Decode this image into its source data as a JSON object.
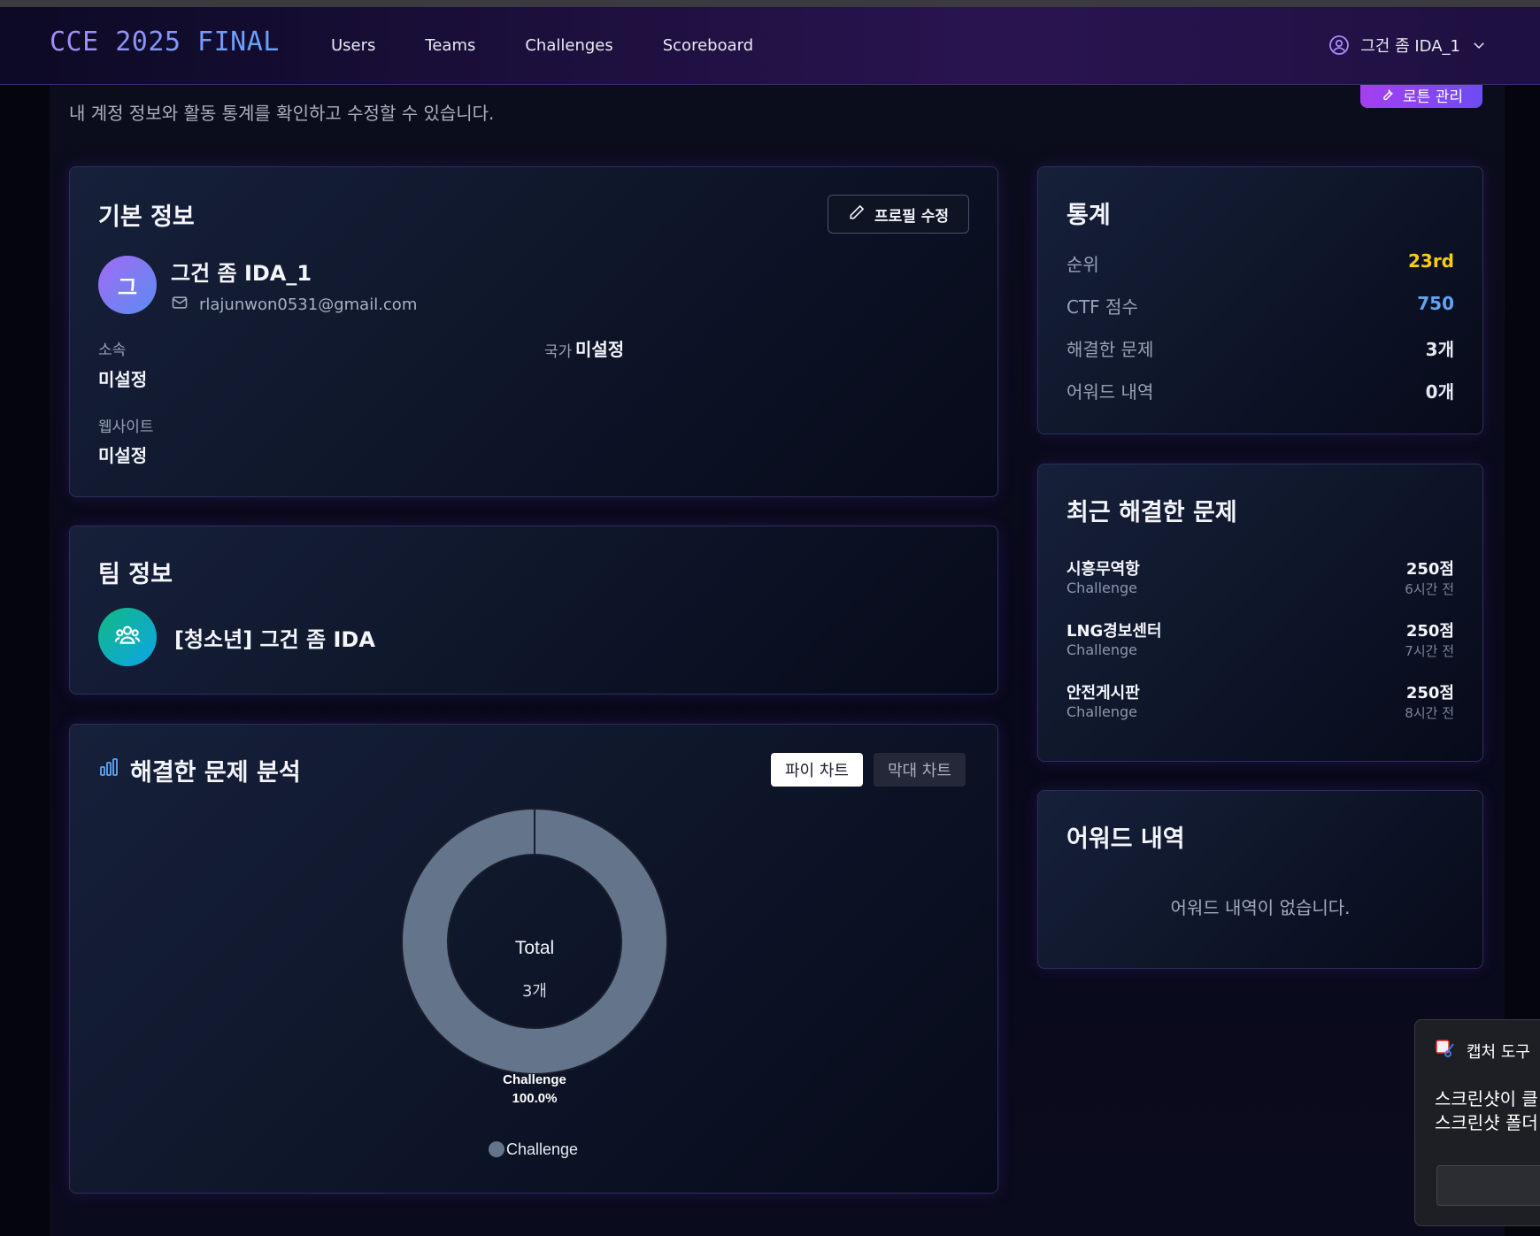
{
  "nav": {
    "brand": "CCE 2025 FINAL",
    "links": [
      "Users",
      "Teams",
      "Challenges",
      "Scoreboard"
    ],
    "user": "그건 좀 IDA_1"
  },
  "page": {
    "subtitle": "내 계정 정보와 활동 통계를 확인하고 수정할 수 있습니다.",
    "admin_button": "로튼 관리"
  },
  "basic_info": {
    "title": "기본 정보",
    "edit_button": "프로필 수정",
    "avatar_letter": "그",
    "username": "그건 좀 IDA_1",
    "email": "rlajunwon0531@gmail.com",
    "affiliation_label": "소속",
    "affiliation_value": "미설정",
    "country_label": "국가",
    "country_value": "미설정",
    "website_label": "웹사이트",
    "website_value": "미설정"
  },
  "team_info": {
    "title": "팀 정보",
    "team_name": "[청소년] 그건 좀 IDA"
  },
  "analysis": {
    "title": "해결한 문제 분석",
    "tab_pie": "파이 차트",
    "tab_bar": "막대 차트",
    "center_label": "Total",
    "center_value": "3개",
    "slice_label": "Challenge",
    "slice_percent": "100.0%",
    "legend": "Challenge",
    "colors": {
      "slice": "#64748b",
      "border": "#1a1d2b"
    }
  },
  "chart_data": {
    "type": "pie",
    "categories": [
      "Challenge"
    ],
    "values": [
      3
    ],
    "percentages": [
      100.0
    ],
    "legend": "bottom",
    "title": ""
  },
  "stats": {
    "title": "통계",
    "rows": [
      {
        "label": "순위",
        "value": "23rd",
        "color": "#facc15"
      },
      {
        "label": "CTF 점수",
        "value": "750",
        "color": "#60a5fa"
      },
      {
        "label": "해결한 문제",
        "value": "3개",
        "color": "#ffffff"
      },
      {
        "label": "어워드 내역",
        "value": "0개",
        "color": "#ffffff"
      }
    ]
  },
  "recent": {
    "title": "최근 해결한 문제",
    "items": [
      {
        "name": "시흥무역항",
        "category": "Challenge",
        "points": "250점",
        "ago": "6시간 전"
      },
      {
        "name": "LNG경보센터",
        "category": "Challenge",
        "points": "250점",
        "ago": "7시간 전"
      },
      {
        "name": "안전게시판",
        "category": "Challenge",
        "points": "250점",
        "ago": "8시간 전"
      }
    ]
  },
  "awards": {
    "title": "어워드 내역",
    "empty": "어워드 내역이 없습니다."
  },
  "snip": {
    "title": "캡처 도구",
    "line1": "스크린샷이 클",
    "line2": "스크린샷 폴더"
  }
}
